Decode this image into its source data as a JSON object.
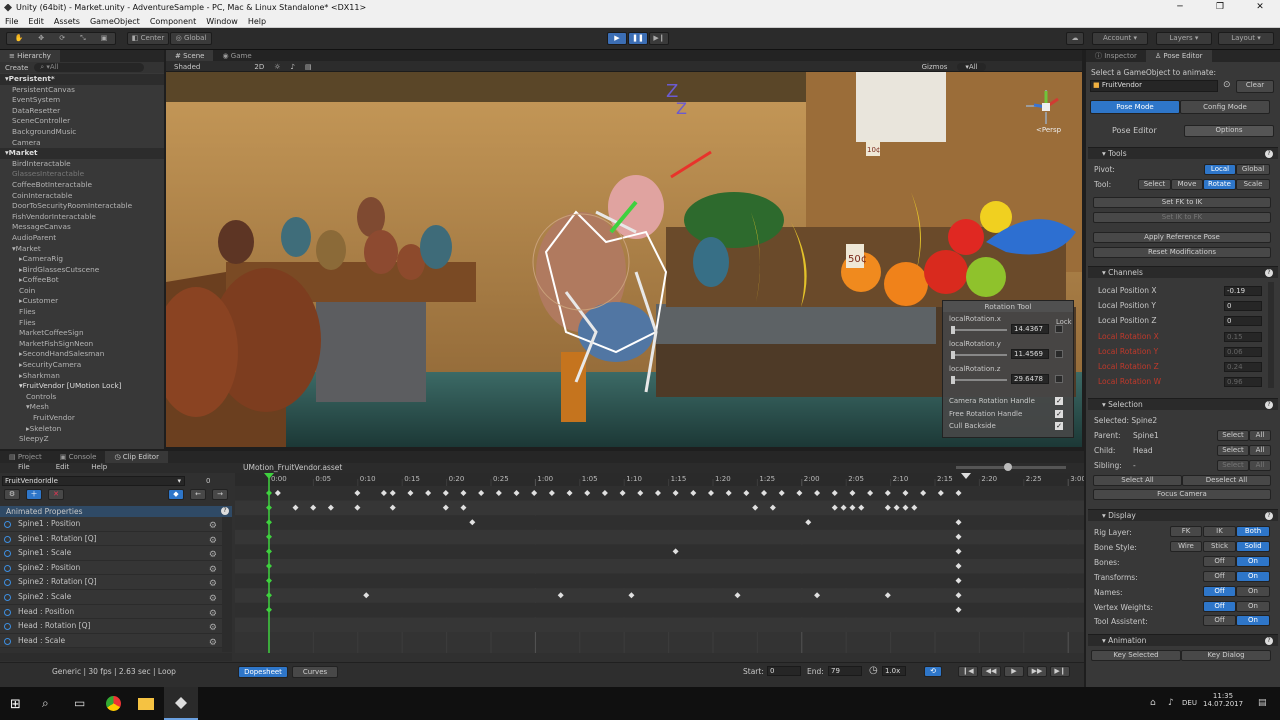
{
  "window": {
    "title": "Unity (64bit) - Market.unity - AdventureSample - PC, Mac & Linux Standalone* <DX11>",
    "controls": [
      "─",
      "❐",
      "✕"
    ]
  },
  "menu": [
    "File",
    "Edit",
    "Assets",
    "GameObject",
    "Component",
    "Window",
    "Help"
  ],
  "toolbar": {
    "center": "Center",
    "global": "Global",
    "account": "Account",
    "layers": "Layers",
    "layout": "Layout"
  },
  "hierarchy": {
    "tab": "Hierarchy",
    "create": "Create",
    "search": "▾All",
    "rows": [
      {
        "t": "▾Persistent*",
        "i": 0,
        "c": "scene"
      },
      {
        "t": "PersistentCanvas",
        "i": 1
      },
      {
        "t": "EventSystem",
        "i": 1
      },
      {
        "t": "DataResetter",
        "i": 1
      },
      {
        "t": "SceneController",
        "i": 1
      },
      {
        "t": "BackgroundMusic",
        "i": 1
      },
      {
        "t": "Camera",
        "i": 1
      },
      {
        "t": "▾Market",
        "i": 0,
        "c": "scene"
      },
      {
        "t": "BirdInteractable",
        "i": 1
      },
      {
        "t": "GlassesInteractable",
        "i": 1,
        "c": "dim"
      },
      {
        "t": "CoffeeBotInteractable",
        "i": 1
      },
      {
        "t": "CoinInteractable",
        "i": 1
      },
      {
        "t": "DoorToSecurityRoomInteractable",
        "i": 1
      },
      {
        "t": "FishVendorInteractable",
        "i": 1
      },
      {
        "t": "MessageCanvas",
        "i": 1
      },
      {
        "t": "AudioParent",
        "i": 1
      },
      {
        "t": "▾Market",
        "i": 1
      },
      {
        "t": "▸CameraRig",
        "i": 2
      },
      {
        "t": "▸BirdGlassesCutscene",
        "i": 2
      },
      {
        "t": "▸CoffeeBot",
        "i": 2
      },
      {
        "t": "Coin",
        "i": 2
      },
      {
        "t": "▸Customer",
        "i": 2
      },
      {
        "t": "Flies",
        "i": 2
      },
      {
        "t": "Flies",
        "i": 2
      },
      {
        "t": "MarketCoffeeSign",
        "i": 2
      },
      {
        "t": "MarketFishSignNeon",
        "i": 2
      },
      {
        "t": "▸SecondHandSalesman",
        "i": 2
      },
      {
        "t": "▸SecurityCamera",
        "i": 2
      },
      {
        "t": "▸Sharkman",
        "i": 2
      },
      {
        "t": "▾FruitVendor [UMotion Lock]",
        "i": 2,
        "c": "sel"
      },
      {
        "t": "Controls",
        "i": 3
      },
      {
        "t": "▾Mesh",
        "i": 3
      },
      {
        "t": "FruitVendor",
        "i": 4
      },
      {
        "t": "▸Skeleton",
        "i": 3
      },
      {
        "t": "SleepyZ",
        "i": 2
      }
    ]
  },
  "scene_tabs": {
    "scene": "Scene",
    "game": "Game",
    "shaded": "Shaded",
    "twod": "2D",
    "gizmos": "Gizmos",
    "all": "▾All",
    "persp": "<Persp"
  },
  "price_tags": [
    "50¢",
    "10¢"
  ],
  "rotation_tool": {
    "title": "Rotation Tool",
    "lock": "Lock",
    "fields": [
      {
        "label": "localRotation.x",
        "value": "14.4367"
      },
      {
        "label": "localRotation.y",
        "value": "11.4569"
      },
      {
        "label": "localRotation.z",
        "value": "29.6478"
      }
    ],
    "toggles": [
      "Camera Rotation Handle",
      "Free Rotation Handle",
      "Cull Backside"
    ]
  },
  "bottom_tabs": {
    "project": "Project",
    "console": "Console",
    "clip_editor": "Clip Editor"
  },
  "clip_menu": [
    "File",
    "Edit",
    "Help"
  ],
  "clip": {
    "name": "FruitVendorIdle",
    "frame": "0",
    "asset": "UMotion_FruitVendor.asset",
    "animated_props": "Animated Properties",
    "properties": [
      "Spine1 : Position",
      "Spine1 : Rotation [Q]",
      "Spine1 : Scale",
      "Spine2 : Position",
      "Spine2 : Rotation [Q]",
      "Spine2 : Scale",
      "Head : Position",
      "Head : Rotation [Q]",
      "Head : Scale"
    ],
    "info": "Generic | 30 fps | 2.63 sec | Loop",
    "dopesheet": "Dopesheet",
    "curves": "Curves",
    "start_label": "Start:",
    "start": "0",
    "end_label": "End:",
    "end": "79",
    "speed": "1.0x",
    "ruler": [
      "0:00",
      "0:05",
      "0:10",
      "0:15",
      "0:20",
      "0:25",
      "1:00",
      "1:05",
      "1:10",
      "1:15",
      "1:20",
      "1:25",
      "2:00",
      "2:05",
      "2:10",
      "2:15",
      "2:20",
      "2:25",
      "3:00"
    ]
  },
  "inspector": {
    "tab1": "Inspector",
    "tab2": "Pose Editor",
    "select_label": "Select a GameObject to animate:",
    "object": "FruitVendor",
    "clear": "Clear",
    "pose_mode": "Pose Mode",
    "config_mode": "Config Mode",
    "pose_editor": "Pose Editor",
    "options": "Options",
    "tools": {
      "title": "Tools",
      "pivot": "Pivot:",
      "local": "Local",
      "global": "Global",
      "tool": "Tool:",
      "select": "Select",
      "move": "Move",
      "rotate": "Rotate",
      "scale": "Scale",
      "fk_ik": "Set FK to IK",
      "ik_fk": "Set IK to FK",
      "apply_ref": "Apply Reference Pose",
      "reset_mod": "Reset Modifications"
    },
    "channels": {
      "title": "Channels",
      "rows": [
        {
          "l": "Local Position X",
          "v": "-0.19"
        },
        {
          "l": "Local Position Y",
          "v": "0"
        },
        {
          "l": "Local Position Z",
          "v": "0"
        },
        {
          "l": "Local Rotation X",
          "v": "0.15"
        },
        {
          "l": "Local Rotation Y",
          "v": "0.06"
        },
        {
          "l": "Local Rotation Z",
          "v": "0.24"
        },
        {
          "l": "Local Rotation W",
          "v": "0.96"
        }
      ]
    },
    "selection": {
      "title": "Selection",
      "selected": "Selected: Spine2",
      "parent": "Parent:",
      "parent_v": "Spine1",
      "child": "Child:",
      "child_v": "Head",
      "sibling": "Sibling:",
      "sibling_v": "-",
      "select": "Select",
      "all": "All",
      "select_all": "Select All",
      "deselect_all": "Deselect All",
      "focus": "Focus Camera"
    },
    "display": {
      "title": "Display",
      "rig": "Rig Layer:",
      "fk": "FK",
      "ik": "IK",
      "both": "Both",
      "bone": "Bone Style:",
      "wire": "Wire",
      "stick": "Stick",
      "solid": "Solid",
      "bones": "Bones:",
      "transforms": "Transforms:",
      "names": "Names:",
      "vertex": "Vertex Weights:",
      "assist": "Tool Assistent:",
      "off": "Off",
      "on": "On"
    },
    "animation": {
      "title": "Animation",
      "key_sel": "Key Selected",
      "key_dialog": "Key Dialog"
    }
  },
  "taskbar": {
    "time": "11:35",
    "date": "14.07.2017",
    "lang": "DEU"
  },
  "colors": {
    "accent": "#2e76c9",
    "playhead": "#3fd13f",
    "keyframe": "#e0e0e0"
  }
}
